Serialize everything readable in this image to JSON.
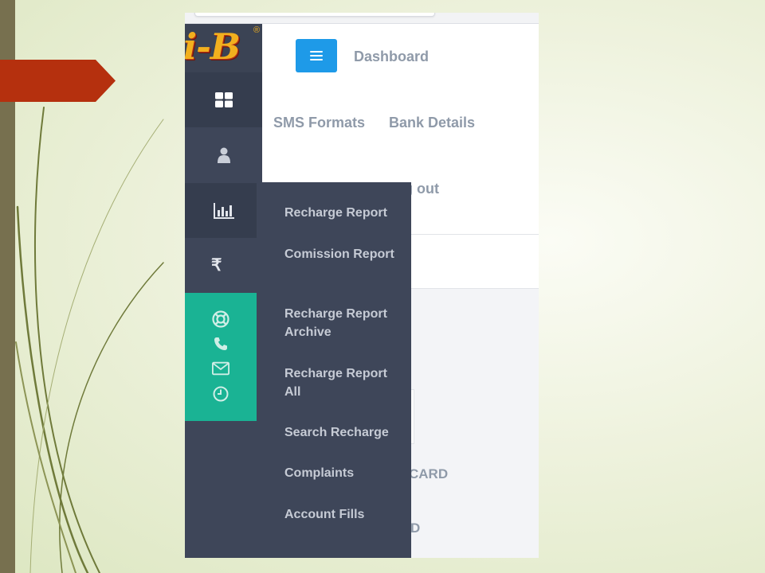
{
  "slide": {
    "colors": {
      "accent_bar": "#77704f",
      "arrow": "#b5300e",
      "swoosh": "#6f7a3a"
    }
  },
  "app": {
    "logo": "i-B",
    "logo_mark": "®",
    "menu_button_icon": "hamburger-icon",
    "dashboard_label": "Dashboard",
    "nav": {
      "sms_formats": "SMS Formats",
      "bank_details": "Bank Details",
      "logout_fragment": "g out"
    },
    "content_fragments": [
      "CARD",
      "D"
    ],
    "sidebar": {
      "items": [
        {
          "icon": "dashboard-grid-icon"
        },
        {
          "icon": "user-icon"
        },
        {
          "icon": "bar-chart-icon",
          "active": true
        },
        {
          "icon": "rupee-icon",
          "glyph": "₹"
        }
      ],
      "contact_icons": [
        "lifebuoy-icon",
        "phone-icon",
        "envelope-icon",
        "clock-icon"
      ]
    },
    "reports_menu": {
      "items": [
        "Recharge Report",
        "Comission Report",
        "Recharge Report Archive",
        "Recharge Report All",
        "Search Recharge",
        "Complaints",
        "Account Fills"
      ]
    },
    "colors": {
      "sidebar": "#3e4659",
      "sidebar_active": "#353d4e",
      "contact_box": "#1ab394",
      "menu_button": "#1e9ae8",
      "nav_text": "#8f9aa9",
      "logo": "#f2b01e"
    }
  }
}
